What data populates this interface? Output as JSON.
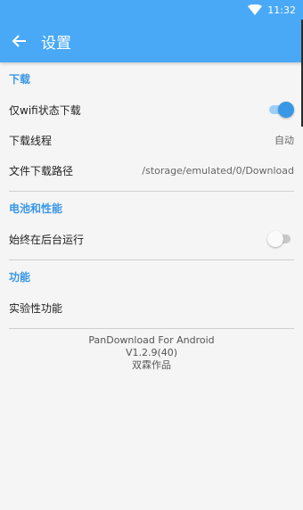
{
  "status_bar": {
    "time": "11:32"
  },
  "toolbar": {
    "title": "设置"
  },
  "sections": [
    {
      "header": "下载",
      "rows": [
        {
          "label": "仅wifi状态下载",
          "switch_on": true
        },
        {
          "label": "下载线程",
          "value": "自动"
        },
        {
          "label": "文件下载路径",
          "value": "/storage/emulated/0/Download"
        }
      ]
    },
    {
      "header": "电池和性能",
      "rows": [
        {
          "label": "始终在后台运行",
          "switch_on": false
        }
      ]
    },
    {
      "header": "功能",
      "rows": [
        {
          "label": "实验性功能"
        }
      ]
    }
  ],
  "footer": {
    "app_name": "PanDownload For Android",
    "version": "V1.2.9(40)",
    "author": "双霖作品"
  },
  "colors": {
    "accent": "#4aa9f6",
    "section_header": "#3a97e6",
    "switch_on_thumb": "#3a97e6",
    "switch_off_thumb": "#fafafa"
  }
}
